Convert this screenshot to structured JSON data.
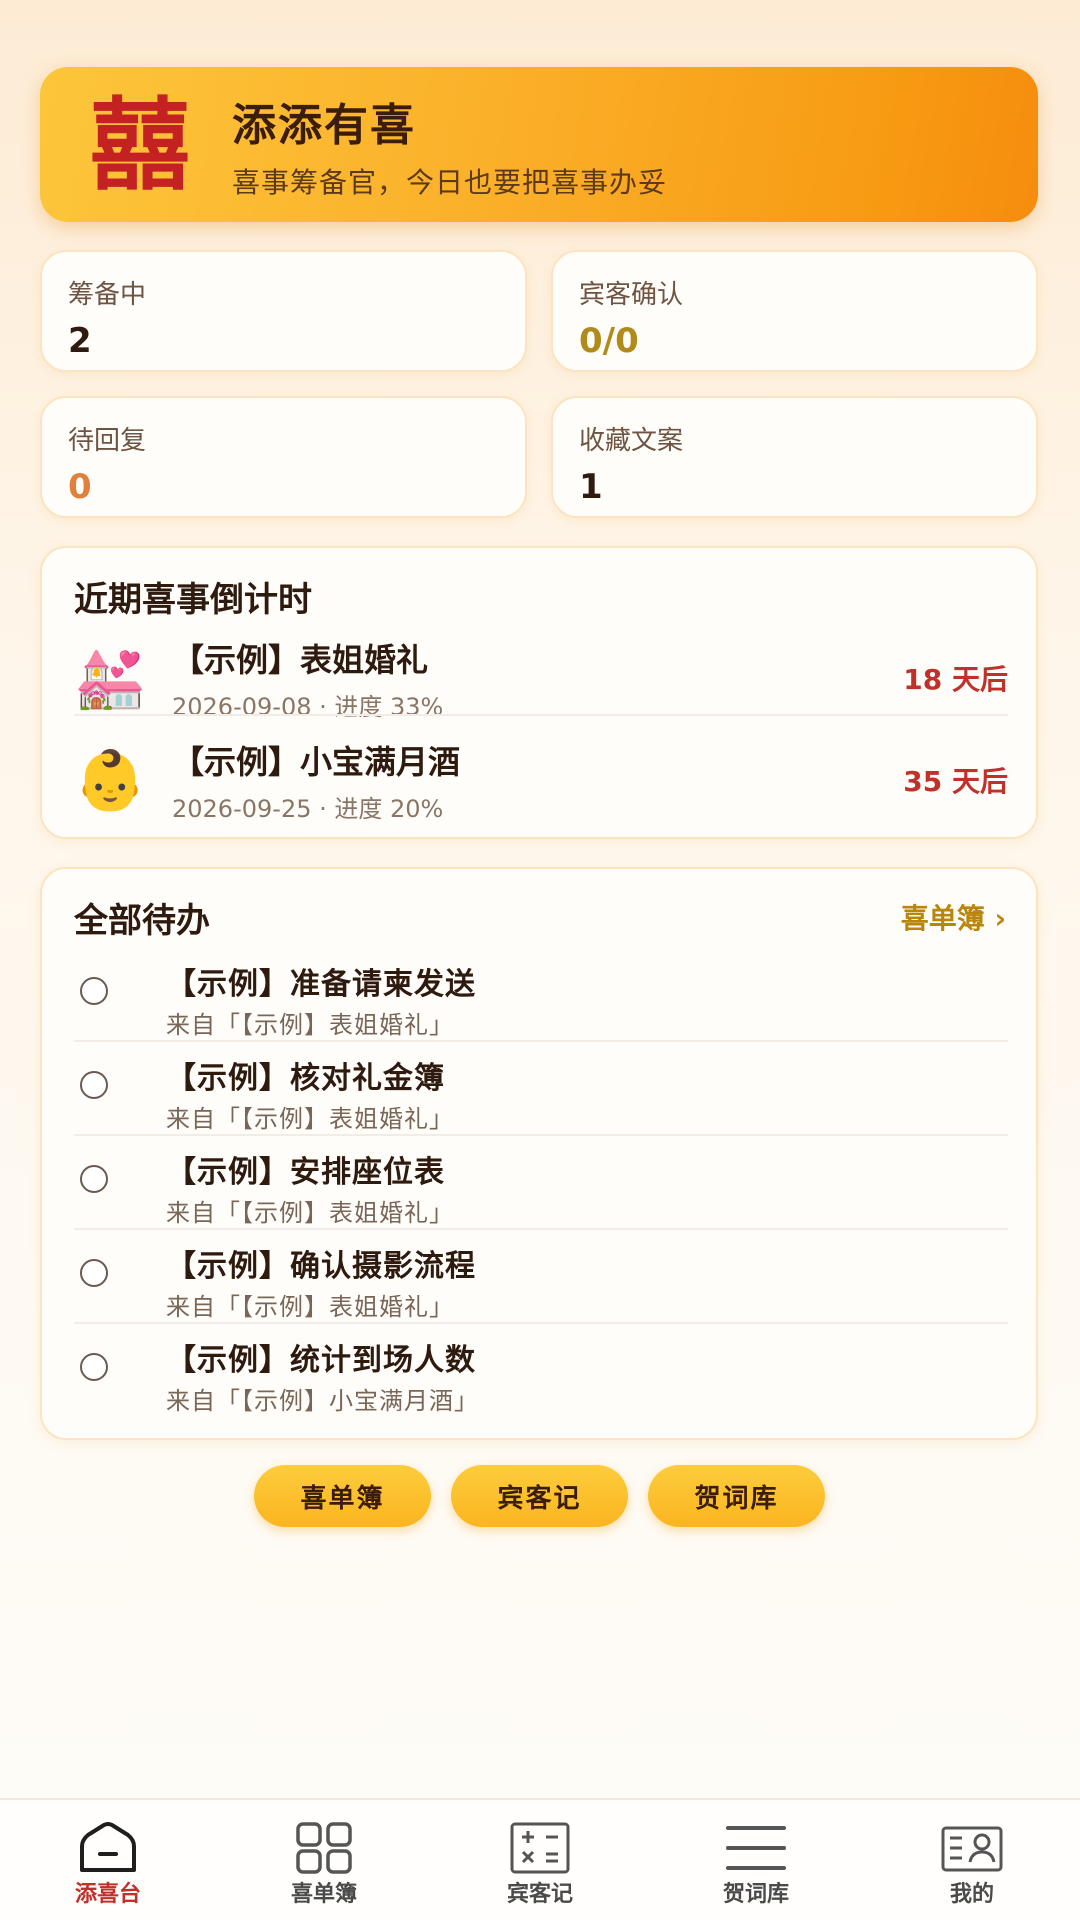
{
  "header": {
    "logo_char": "囍",
    "title": "添添有喜",
    "subtitle": "喜事筹备官，今日也要把喜事办妥"
  },
  "stats": [
    {
      "label": "筹备中",
      "value": "2",
      "color": "#2f1a10"
    },
    {
      "label": "宾客确认",
      "value": "0/0",
      "color": "#b08a1a"
    },
    {
      "label": "待回复",
      "value": "0",
      "color": "#e0803a"
    },
    {
      "label": "收藏文案",
      "value": "1",
      "color": "#2f1a10"
    }
  ],
  "countdown": {
    "title": "近期喜事倒计时",
    "items": [
      {
        "icon": "wedding-chapel-icon",
        "emoji": "💒",
        "name": "【示例】表姐婚礼",
        "meta": "2026-09-08 · 进度 33%",
        "days": "18 天后"
      },
      {
        "icon": "baby-icon",
        "emoji": "👶",
        "name": "【示例】小宝满月酒",
        "meta": "2026-09-25 · 进度 20%",
        "days": "35 天后"
      }
    ]
  },
  "todos": {
    "title": "全部待办",
    "more_link": "喜单簿 ›",
    "items": [
      {
        "text": "【示例】准备请柬发送",
        "from": "来自「【示例】表姐婚礼」"
      },
      {
        "text": "【示例】核对礼金簿",
        "from": "来自「【示例】表姐婚礼」"
      },
      {
        "text": "【示例】安排座位表",
        "from": "来自「【示例】表姐婚礼」"
      },
      {
        "text": "【示例】确认摄影流程",
        "from": "来自「【示例】表姐婚礼」"
      },
      {
        "text": "【示例】统计到场人数",
        "from": "来自「【示例】小宝满月酒」"
      }
    ]
  },
  "quick_buttons": [
    "喜单簿",
    "宾客记",
    "贺词库"
  ],
  "nav": [
    {
      "label": "添喜台",
      "icon": "home-icon",
      "active": true
    },
    {
      "label": "喜单簿",
      "icon": "grid-icon",
      "active": false
    },
    {
      "label": "宾客记",
      "icon": "calculator-icon",
      "active": false
    },
    {
      "label": "贺词库",
      "icon": "menu-icon",
      "active": false
    },
    {
      "label": "我的",
      "icon": "profile-card-icon",
      "active": false
    }
  ],
  "colors": {
    "accent_red": "#c2302a",
    "gold": "#b8860b",
    "banner_orange": "#f79a12"
  }
}
